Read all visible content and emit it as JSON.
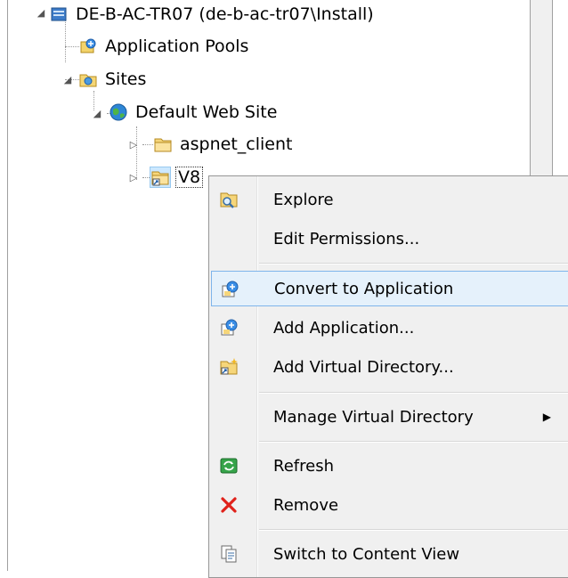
{
  "tree": {
    "server": {
      "label": "DE-B-AC-TR07 (de-b-ac-tr07\\Install)"
    },
    "app_pools": {
      "label": "Application Pools"
    },
    "sites": {
      "label": "Sites"
    },
    "default_site": {
      "label": "Default Web Site"
    },
    "aspnet_client": {
      "label": "aspnet_client"
    },
    "v8": {
      "label": "V8"
    }
  },
  "context_menu": {
    "items": [
      {
        "label": "Explore",
        "icon": "explore-icon"
      },
      {
        "label": "Edit Permissions...",
        "icon": ""
      },
      {
        "label": "Convert to Application",
        "icon": "convert-app-icon"
      },
      {
        "label": "Add Application...",
        "icon": "add-app-icon"
      },
      {
        "label": "Add Virtual Directory...",
        "icon": "add-vdir-icon"
      },
      {
        "label": "Manage Virtual Directory",
        "icon": "",
        "submenu": true
      },
      {
        "label": "Refresh",
        "icon": "refresh-icon"
      },
      {
        "label": "Remove",
        "icon": "remove-icon"
      },
      {
        "label": "Switch to Content View",
        "icon": "content-view-icon"
      }
    ],
    "highlight_color": "#e5f1fb",
    "highlight_border": "#7eb4ea"
  }
}
